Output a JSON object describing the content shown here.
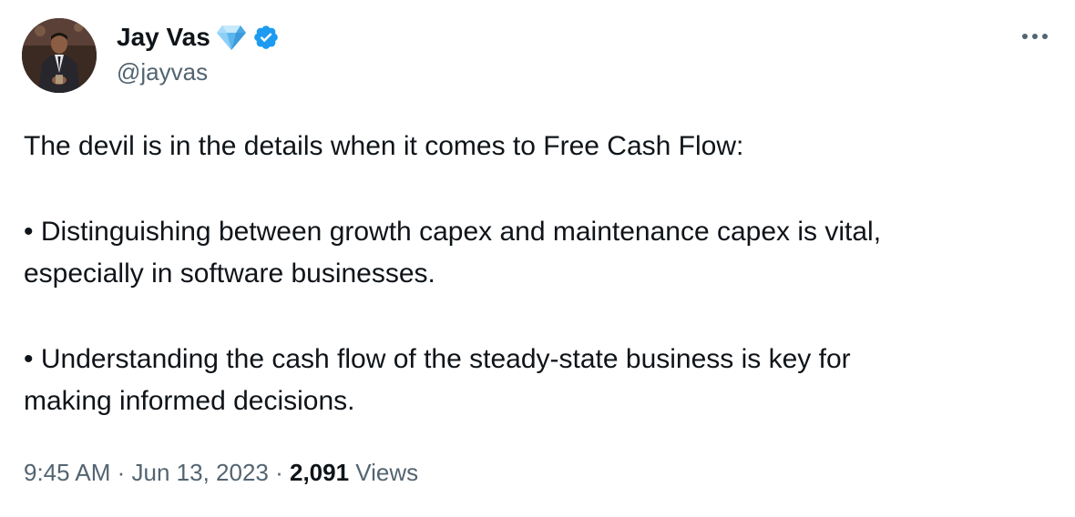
{
  "author": {
    "display_name": "Jay Vas",
    "handle": "@jayvas"
  },
  "tweet": {
    "intro": "The devil is in the details when it comes to Free Cash Flow:",
    "bullet_1_line_1": "• Distinguishing between growth capex and maintenance capex is vital,",
    "bullet_1_line_2": "especially in software businesses.",
    "bullet_2_line_1": "• Understanding the cash flow of the steady-state business is key for",
    "bullet_2_line_2": "making informed decisions."
  },
  "meta": {
    "time": "9:45 AM",
    "separator": " · ",
    "date": "Jun 13, 2023",
    "views_count": "2,091",
    "views_label": " Views"
  },
  "icons": {
    "diamond": "diamond-icon",
    "verified": "verified-badge-icon",
    "more": "more-icon"
  },
  "colors": {
    "verified_blue": "#1d9bf0",
    "secondary_text": "#536471",
    "primary_text": "#0f1419"
  }
}
